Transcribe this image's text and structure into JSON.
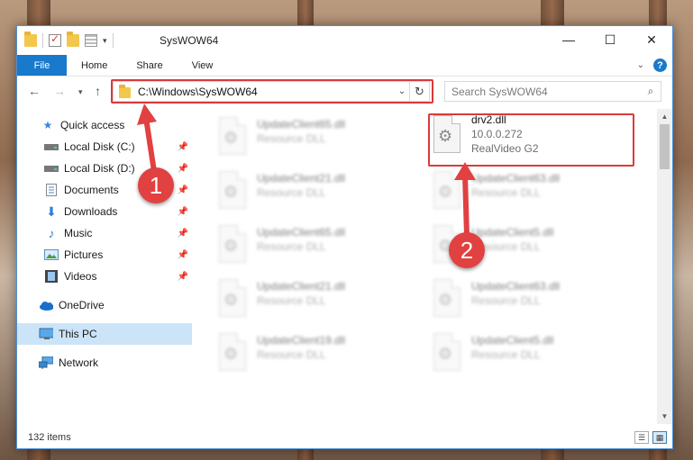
{
  "window": {
    "title": "SysWOW64"
  },
  "window_controls": {
    "minimize": "—",
    "maximize": "☐",
    "close": "✕"
  },
  "ribbon": {
    "tabs": [
      "File",
      "Home",
      "Share",
      "View"
    ]
  },
  "navigation": {
    "address": "C:\\Windows\\SysWOW64",
    "search_placeholder": "Search SysWOW64"
  },
  "sidebar": {
    "items": [
      {
        "label": "Quick access",
        "icon": "star-icon"
      },
      {
        "label": "Local Disk (C:)",
        "icon": "drive-icon",
        "pinned": true
      },
      {
        "label": "Local Disk (D:)",
        "icon": "drive-icon",
        "pinned": true
      },
      {
        "label": "Documents",
        "icon": "documents-icon",
        "pinned": true
      },
      {
        "label": "Downloads",
        "icon": "download-icon",
        "pinned": true
      },
      {
        "label": "Music",
        "icon": "music-icon",
        "pinned": true
      },
      {
        "label": "Pictures",
        "icon": "pictures-icon",
        "pinned": true
      },
      {
        "label": "Videos",
        "icon": "videos-icon",
        "pinned": true
      },
      {
        "label": "OneDrive",
        "icon": "cloud-icon"
      },
      {
        "label": "This PC",
        "icon": "computer-icon",
        "selected": true
      },
      {
        "label": "Network",
        "icon": "network-icon"
      }
    ]
  },
  "files": {
    "highlighted": {
      "name": "drv2.dll",
      "version": "10.0.0.272",
      "description": "RealVideo G2"
    },
    "left_column": [
      {
        "name": "UpdateClient65.dll",
        "type": "Resource DLL"
      },
      {
        "name": "UpdateClient21.dll",
        "type": "Resource DLL"
      },
      {
        "name": "UpdateClient65.dll",
        "type": "Resource DLL"
      },
      {
        "name": "UpdateClient21.dll",
        "type": "Resource DLL"
      },
      {
        "name": "UpdateClient19.dll",
        "type": "Resource DLL"
      }
    ],
    "right_column": [
      {
        "name": "UpdateClient63.dll",
        "type": "Resource DLL"
      },
      {
        "name": "UpdateClient5.dll",
        "type": "Resource DLL"
      },
      {
        "name": "UpdateClient63.dll",
        "type": "Resource DLL"
      },
      {
        "name": "UpdateClient5.dll",
        "type": "Resource DLL"
      }
    ]
  },
  "status": {
    "item_count": "132 items"
  },
  "annotations": {
    "marker_1": "1",
    "marker_2": "2"
  },
  "colors": {
    "accent": "#1979ca",
    "highlight": "#d93a3a",
    "selected": "#cce4f7"
  }
}
